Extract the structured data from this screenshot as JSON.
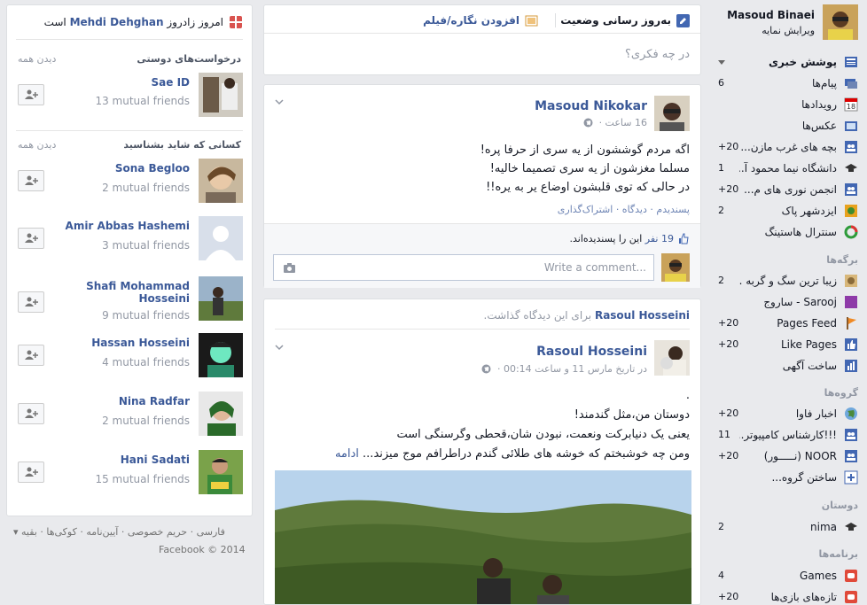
{
  "nav": {
    "profile": {
      "name": "Masoud Binaei",
      "edit": "ویرایش نمایه"
    },
    "news_feed": "پوشش خبری",
    "items": [
      {
        "label": "پیام‌ها",
        "count": "6"
      },
      {
        "label": "رویدادها",
        "count": ""
      },
      {
        "label": "عکس‌ها",
        "count": ""
      },
      {
        "label": "بچه های غرب مازن...",
        "count": "+20"
      },
      {
        "label": "دانشگاه نیما محمود آ...",
        "count": "1"
      },
      {
        "label": "انجمن نوری های م...",
        "count": "+20"
      },
      {
        "label": "ایزدشهر پاک",
        "count": "2"
      },
      {
        "label": "سنترال هاستینگ",
        "count": ""
      }
    ],
    "pages_header": "برگه‌ها",
    "pages": [
      {
        "label": "زیبا ترین سگ و گربه ...",
        "count": "2"
      },
      {
        "label": "Sarooj - ساروج",
        "count": ""
      },
      {
        "label": "Pages Feed",
        "count": "+20"
      },
      {
        "label": "Like Pages",
        "count": "+20"
      },
      {
        "label": "ساخت آگهی",
        "count": ""
      }
    ],
    "groups_header": "گروه‌ها",
    "groups": [
      {
        "label": "اخبار فاوا",
        "count": "+20"
      },
      {
        "label": "!!!کارشناس کامپیوتر...",
        "count": "11"
      },
      {
        "label": "NOOR (نـــــور)",
        "count": "+20"
      },
      {
        "label": "ساختن گروه...",
        "count": ""
      }
    ],
    "friends_header": "دوستان",
    "friends": [
      {
        "label": "nima",
        "count": "2"
      }
    ],
    "apps_header": "برنامه‌ها",
    "apps": [
      {
        "label": "Games",
        "count": "4"
      },
      {
        "label": "تازه‌های بازی‌ها",
        "count": "+20"
      }
    ]
  },
  "composer": {
    "tab_status": "به‌روز رسانی وضعیت",
    "tab_photo": "افزودن نگاره/فیلم",
    "placeholder": "در چه فکری؟"
  },
  "post1": {
    "author": "Masoud Nikokar",
    "time": "16 ساعت ·",
    "lines": [
      "اگه مردم گوششون از یه سری از حرفا پره!",
      "مسلما مغزشون از یه سری تصمیما خالیه!",
      "در حالی که توی قلبشون اوضاع یر به یره!!"
    ],
    "actions": "پسندیدم · دیدگاه · اشتراک‌گذاری",
    "likes_count": "19 نفر",
    "likes_suffix": "این را پسندیده‌اند.",
    "comment_placeholder": "Write a comment..."
  },
  "post2": {
    "story_actor": "Rasoul Hosseini",
    "story_suffix": "برای این دیدگاه گذاشت.",
    "author": "Rasoul Hosseini",
    "time": "در تاریخ مارس 11 و ساعت 00:14 ·",
    "lines": [
      ".",
      "دوستان من،مثل گندمند!",
      "یعنی یک دنیابرکت ونعمت، نبودن شان،قحطی وگرسنگی است"
    ],
    "last_line": "ومن چه خوشبختم که خوشه های طلائی گندم دراطرافم موج میزند...",
    "more": "ادامه"
  },
  "left": {
    "birthday_prefix": "امروز زادروز",
    "birthday_name": "Mehdi Dehghan",
    "birthday_suffix": "است",
    "requests_header": "درخواست‌های دوستی",
    "see_all": "دیدن همه",
    "requests": [
      {
        "name": "Sae ID",
        "mutual": "13 mutual friends"
      }
    ],
    "pymk_header": "کسانی که شاید بشناسید",
    "pymk": [
      {
        "name": "Sona Begloo",
        "mutual": "2 mutual friends"
      },
      {
        "name": "Amir Abbas Hashemi",
        "mutual": "3 mutual friends"
      },
      {
        "name": "Shafi Mohammad Hosseini",
        "mutual": "9 mutual friends"
      },
      {
        "name": "Hassan Hosseini",
        "mutual": "4 mutual friends"
      },
      {
        "name": "Nina Radfar",
        "mutual": "2 mutual friends"
      },
      {
        "name": "Hani Sadati",
        "mutual": "15 mutual friends"
      }
    ]
  },
  "footer": {
    "links": "فارسی · حریم خصوصی · آیین‌نامه · کوکی‌ها · بقیه ▾",
    "copyright": "Facebook © 2014"
  }
}
